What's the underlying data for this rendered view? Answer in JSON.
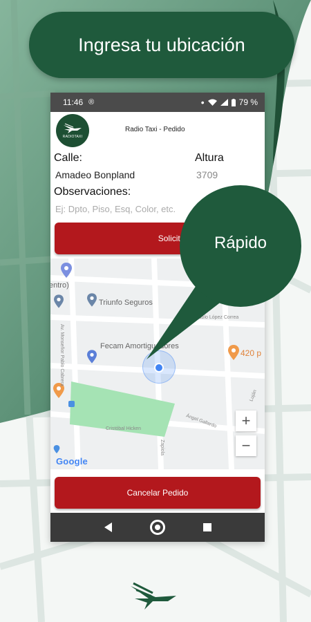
{
  "headline": "Ingresa tu ubicación",
  "status_bar": {
    "time": "11:46",
    "battery": "79 %"
  },
  "app_bar": {
    "title": "Radio Taxi - Pedido",
    "logo_text": "RADIOTAXI"
  },
  "form": {
    "street_label": "Calle:",
    "street_value": "Amadeo Bonpland",
    "number_label": "Altura",
    "number_value": "3709",
    "notes_label": "Observaciones:",
    "notes_placeholder": "Ej: Dpto, Piso, Esq, Color, etc."
  },
  "buttons": {
    "request": "Solicitar Taxi",
    "request_visible": "Solicitar Ta",
    "cancel": "Cancelar Pedido"
  },
  "map": {
    "labels": {
      "centro": "entro)",
      "triunfo": "Triunfo Seguros",
      "fecam": "Fecam Amortiguadores",
      "lopez": "Pablo López Correa",
      "restaurant": "420 p",
      "civil": "Cristóbal Hicken",
      "street_vertical": "Av. Monseñor Pablo Cabrera",
      "angel": "Ángel Gallardo",
      "zapiola": "Zapiola",
      "lujan": "Luján"
    },
    "zoom_in": "+",
    "zoom_out": "−",
    "attribution": "Google"
  },
  "callout": "Rápido",
  "colors": {
    "brand_green": "#1f5a3c",
    "button_red": "#b3181d"
  }
}
